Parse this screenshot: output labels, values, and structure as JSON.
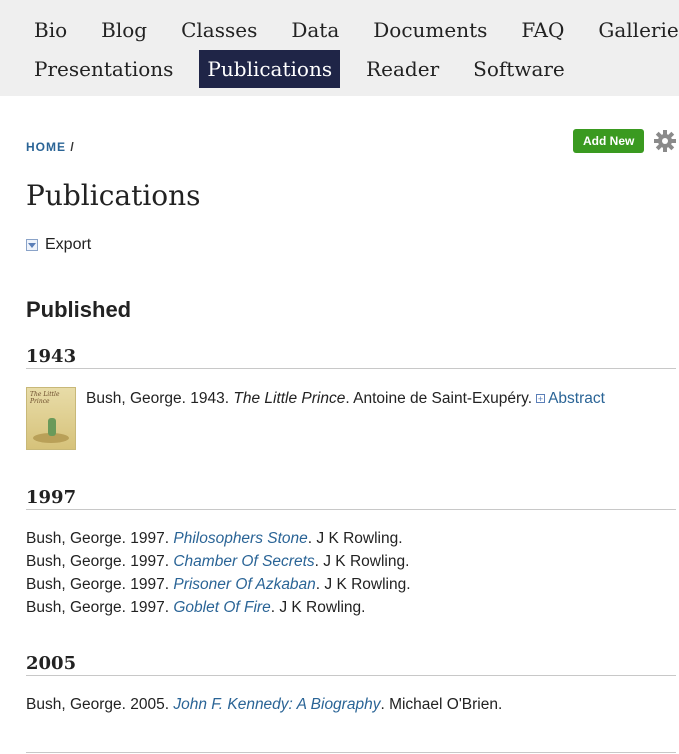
{
  "nav": {
    "row1": [
      "Bio",
      "Blog",
      "Classes",
      "Data",
      "Documents",
      "FAQ",
      "Galleries"
    ],
    "row2": [
      "Presentations",
      "Publications",
      "Reader",
      "Software"
    ],
    "active": "Publications"
  },
  "breadcrumb": {
    "home": "HOME",
    "sep": "/"
  },
  "toolbar": {
    "add_new": "Add New",
    "settings_icon": "gear-icon"
  },
  "page": {
    "title": "Publications",
    "export_label": "Export",
    "section": "Published"
  },
  "groups": [
    {
      "year": "1943",
      "entries": [
        {
          "prefix": "Bush, George. 1943. ",
          "title": "The Little Prince",
          "suffix": ". Antoine de Saint-Exupéry.",
          "abstract": "Abstract",
          "cover_text": "The Little Prince"
        }
      ]
    },
    {
      "year": "1997",
      "entries": [
        {
          "prefix": "Bush, George. 1997. ",
          "title": "Philosophers Stone",
          "suffix": ". J K Rowling."
        },
        {
          "prefix": "Bush, George. 1997. ",
          "title": "Chamber Of Secrets",
          "suffix": ". J K Rowling."
        },
        {
          "prefix": "Bush, George. 1997. ",
          "title": "Prisoner Of Azkaban",
          "suffix": ". J K Rowling."
        },
        {
          "prefix": "Bush, George. 1997. ",
          "title": "Goblet Of Fire",
          "suffix": ". J K Rowling."
        }
      ]
    },
    {
      "year": "2005",
      "entries": [
        {
          "prefix": "Bush, George. 2005. ",
          "title": "John F. Kennedy: A Biography",
          "suffix": ". Michael O'Brien."
        }
      ]
    }
  ],
  "colors": {
    "nav_active_bg": "#1f2547",
    "link": "#2a6496",
    "add_new_bg": "#3a9a20"
  }
}
